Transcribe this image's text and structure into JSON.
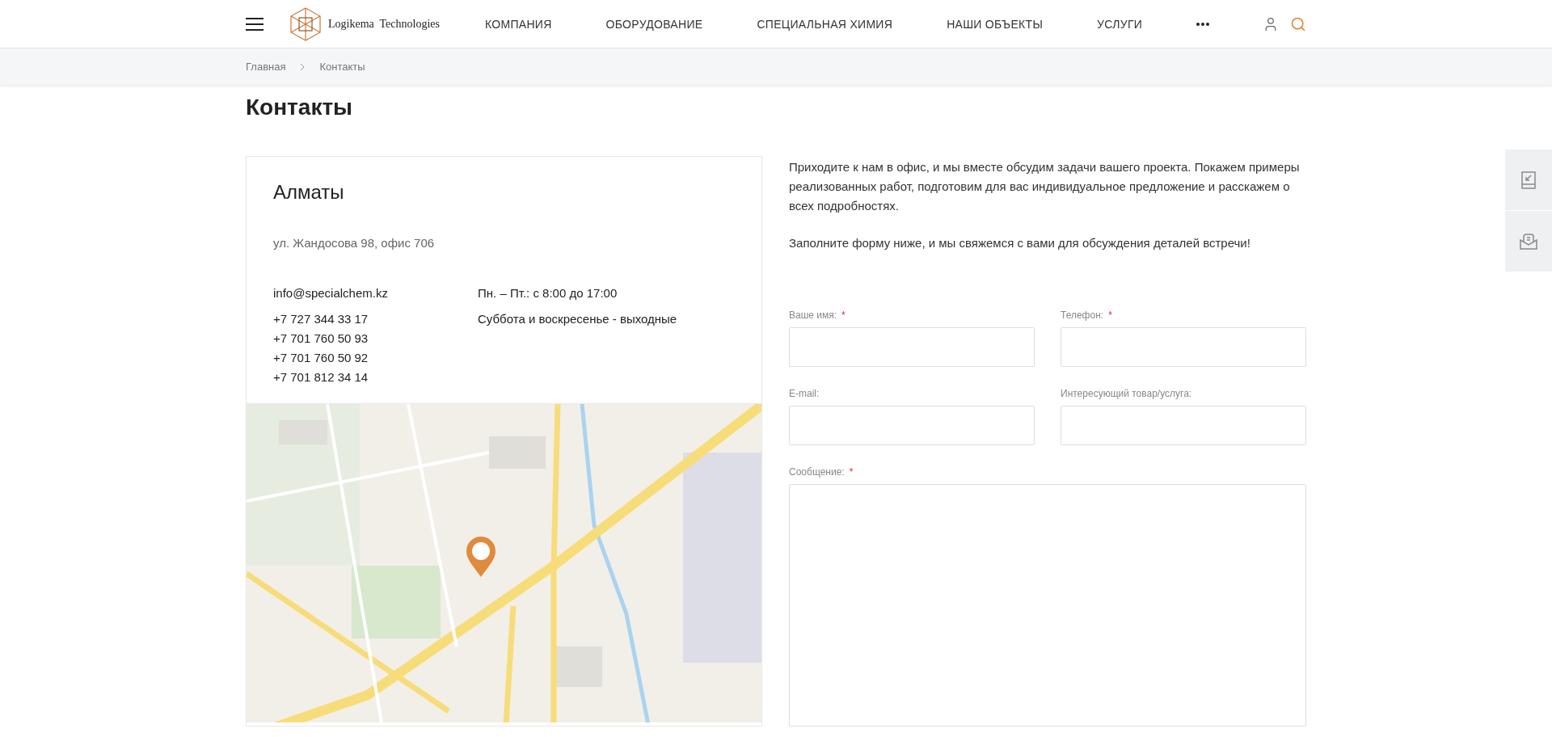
{
  "header": {
    "logo": "Logikema  Technologies",
    "nav": [
      {
        "label": "КОМПАНИЯ"
      },
      {
        "label": "ОБОРУДОВАНИЕ"
      },
      {
        "label": "СПЕЦИАЛЬНАЯ ХИМИЯ"
      },
      {
        "label": "НАШИ ОБЪЕКТЫ"
      },
      {
        "label": "УСЛУГИ"
      }
    ]
  },
  "breadcrumbs": [
    "Главная",
    "Контакты"
  ],
  "title": "Контакты",
  "office": {
    "city": "Алматы",
    "address": "ул. Жандосова 98, офис 706",
    "email": "info@specialchem.kz",
    "phones": [
      "+7 727 344 33 17",
      "+7 701 760 50 93",
      "+7 701 760 50 92",
      "+7 701 812 34 14"
    ],
    "hours": [
      "Пн. – Пт.: с 8:00 до 17:00",
      "Суббота и воскресенье - выходные"
    ],
    "map": {
      "kind": "picture"
    }
  },
  "intro": [
    "Приходите к нам в офис, и мы вместе обсудим задачи вашего проекта. Покажем примеры реализованных работ, подготовим для вас индивидуальное предложение и расскажем о всех подробностях.",
    "Заполните форму ниже, и мы свяжемся с вами для обсуждения деталей встречи!"
  ],
  "form": {
    "required_mark": "*",
    "fields": [
      {
        "label": "Ваше имя:",
        "required": true,
        "kind": "input"
      },
      {
        "label": "Телефон:",
        "required": true,
        "kind": "input"
      },
      {
        "label": "E-mail:",
        "required": false,
        "kind": "input"
      },
      {
        "label": "Интересующий товар/услуга:",
        "required": false,
        "kind": "input"
      },
      {
        "label": "Сообщение:",
        "required": true,
        "kind": "textarea"
      }
    ]
  }
}
